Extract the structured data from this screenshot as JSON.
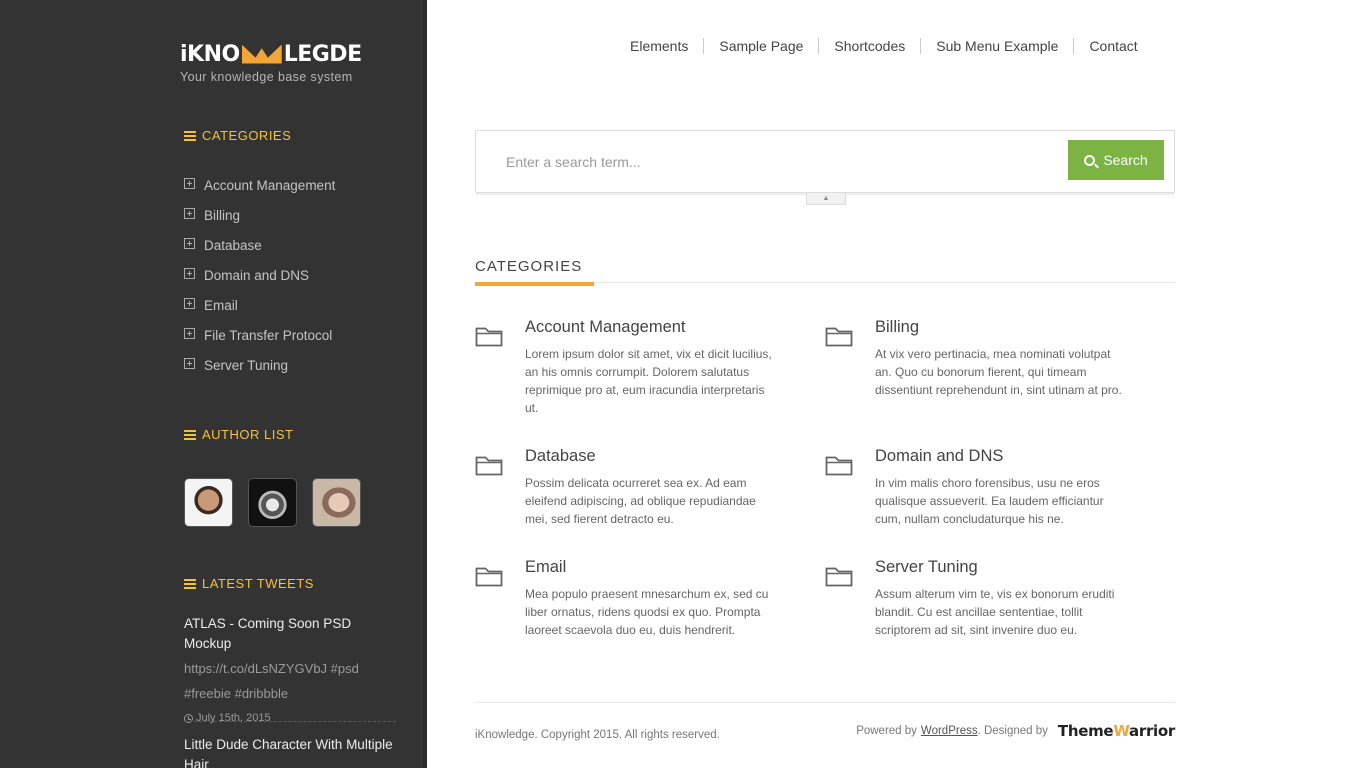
{
  "brand": {
    "logo_left": "iKNO",
    "logo_right": "LEGDE",
    "tagline": "Your knowledge base system"
  },
  "nav": [
    {
      "label": "Elements"
    },
    {
      "label": "Sample Page"
    },
    {
      "label": "Shortcodes"
    },
    {
      "label": "Sub Menu Example"
    },
    {
      "label": "Contact"
    }
  ],
  "sidebar": {
    "categories_title": "CATEGORIES",
    "categories": [
      "Account Management",
      "Billing",
      "Database",
      "Domain and DNS",
      "Email",
      "File Transfer Protocol",
      "Server Tuning"
    ],
    "authors_title": "AUTHOR LIST",
    "tweets_title": "LATEST TWEETS",
    "tweets": [
      {
        "title": "ATLAS - Coming Soon PSD Mockup",
        "body": "https://t.co/dLsNZYGVbJ #psd #freebie #dribbble",
        "date": "July 15th, 2015"
      },
      {
        "title": "Little Dude Character With Multiple Hair",
        "body": "",
        "date": ""
      }
    ]
  },
  "search": {
    "placeholder": "Enter a search term...",
    "button_label": "Search",
    "toggle_glyph": "▲"
  },
  "main": {
    "section_title": "CATEGORIES",
    "categories": [
      {
        "title": "Account Management",
        "desc": "Lorem ipsum dolor sit amet, vix et dicit lucilius, an his omnis corrumpit. Dolorem salutatus reprimique pro at, eum iracundia interpretaris ut."
      },
      {
        "title": "Billing",
        "desc": "At vix vero pertinacia, mea nominati volutpat an. Quo cu bonorum fierent, qui timeam dissentiunt reprehendunt in, sint utinam at pro."
      },
      {
        "title": "Database",
        "desc": "Possim delicata ocurreret sea ex. Ad eam eleifend adipiscing, ad oblique repudiandae mei, sed fierent detracto eu."
      },
      {
        "title": "Domain and DNS",
        "desc": "In vim malis choro forensibus, usu ne eros qualisque assueverit. Ea laudem efficiantur cum, nullam concludaturque his ne."
      },
      {
        "title": "Email",
        "desc": "Mea populo praesent mnesarchum ex, sed cu liber ornatus, ridens quodsi ex quo. Prompta laoreet scaevola duo eu, duis hendrerit."
      },
      {
        "title": "Server Tuning",
        "desc": "Assum alterum vim te, vis ex bonorum eruditi blandit. Cu est ancillae sententiae, tollit scriptorem ad sit, sint invenire duo eu."
      }
    ]
  },
  "footer": {
    "copyright": "iKnowledge. Copyright 2015. All rights reserved.",
    "powered_by": "Powered by",
    "wordpress": "WordPress",
    "designed_by": ". Designed by",
    "designer_left": "Theme",
    "designer_w": "W",
    "designer_right": "arrior"
  },
  "colors": {
    "sidebar_bg": "#333333",
    "accent_orange": "#f3a536",
    "widget_title": "#f3c236",
    "search_green": "#7cb342"
  }
}
